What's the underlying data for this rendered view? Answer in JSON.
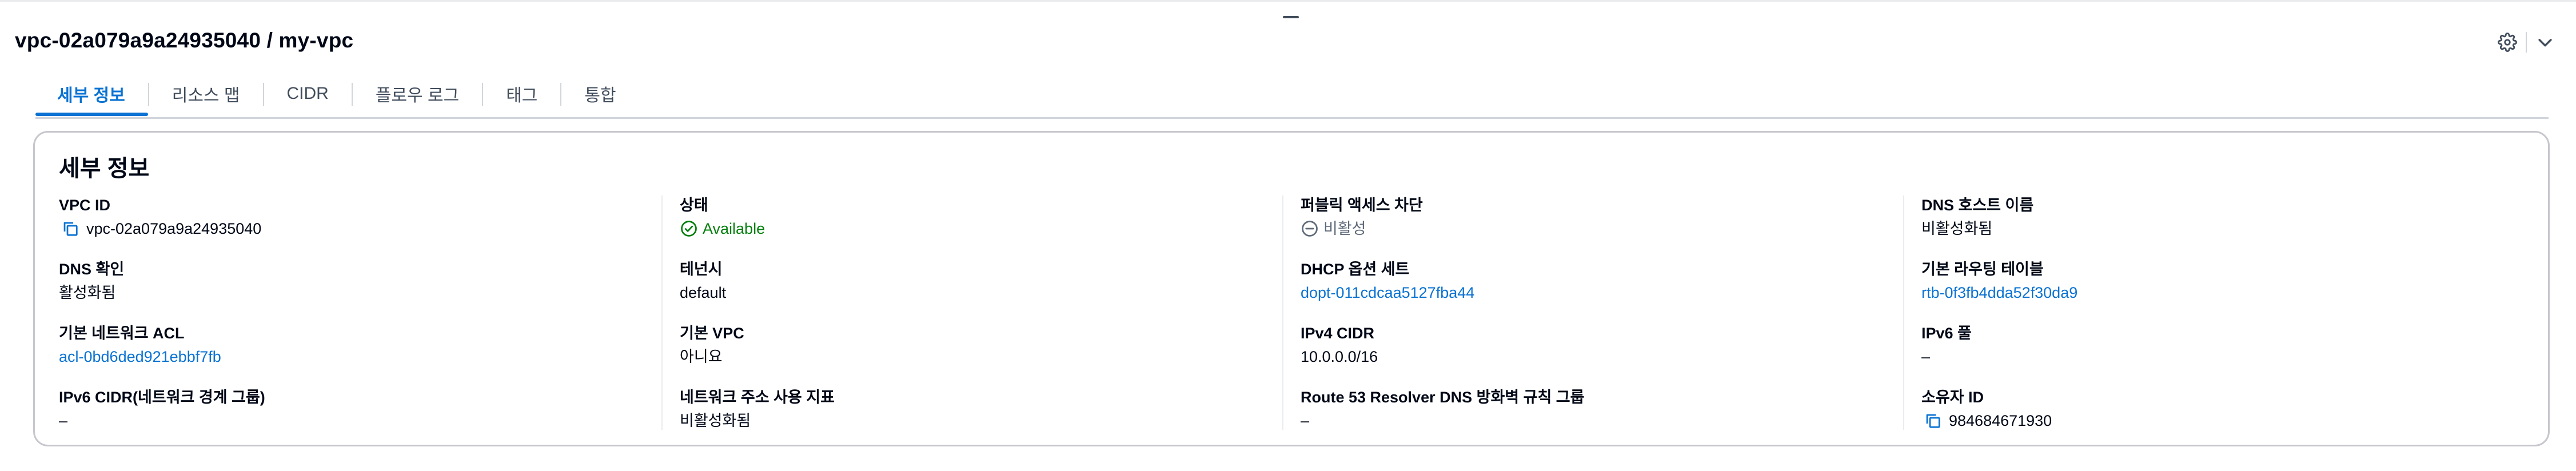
{
  "header": {
    "title": "vpc-02a079a9a24935040 / my-vpc",
    "settings_icon": "gear-icon",
    "collapse_icon": "chevron-down-icon"
  },
  "tabs": [
    {
      "label": "세부 정보",
      "active": true
    },
    {
      "label": "리소스 맵"
    },
    {
      "label": "CIDR"
    },
    {
      "label": "플로우 로그"
    },
    {
      "label": "태그"
    },
    {
      "label": "통합"
    }
  ],
  "details": {
    "title": "세부 정보",
    "col1": {
      "vpc_id_label": "VPC ID",
      "vpc_id_value": "vpc-02a079a9a24935040",
      "dns_resolution_label": "DNS 확인",
      "dns_resolution_value": "활성화됨",
      "network_acl_label": "기본 네트워크 ACL",
      "network_acl_value": "acl-0bd6ded921ebbf7fb",
      "ipv6_cidr_label": "IPv6 CIDR(네트워크 경계 그룹)",
      "ipv6_cidr_value": "–"
    },
    "col2": {
      "state_label": "상태",
      "state_value": "Available",
      "tenancy_label": "테넌시",
      "tenancy_value": "default",
      "default_vpc_label": "기본 VPC",
      "default_vpc_value": "아니요",
      "network_usage_label": "네트워크 주소 사용 지표",
      "network_usage_value": "비활성화됨"
    },
    "col3": {
      "block_public_label": "퍼블릭 액세스 차단",
      "block_public_value": "비활성",
      "dhcp_label": "DHCP 옵션 세트",
      "dhcp_value": "dopt-011cdcaa5127fba44",
      "ipv4_label": "IPv4 CIDR",
      "ipv4_value": "10.0.0.0/16",
      "resolver_label": "Route 53 Resolver DNS 방화벽 규칙 그룹",
      "resolver_value": "–"
    },
    "col4": {
      "dns_hostnames_label": "DNS 호스트 이름",
      "dns_hostnames_value": "비활성화됨",
      "main_route_label": "기본 라우팅 테이블",
      "main_route_value": "rtb-0f3fb4dda52f30da9",
      "ipv6_pool_label": "IPv6 풀",
      "ipv6_pool_value": "–",
      "owner_label": "소유자 ID",
      "owner_value": "984684671930"
    }
  },
  "colors": {
    "link": "#0972d3",
    "success": "#037f0c",
    "muted": "#5f6b7a",
    "text": "#000716"
  }
}
